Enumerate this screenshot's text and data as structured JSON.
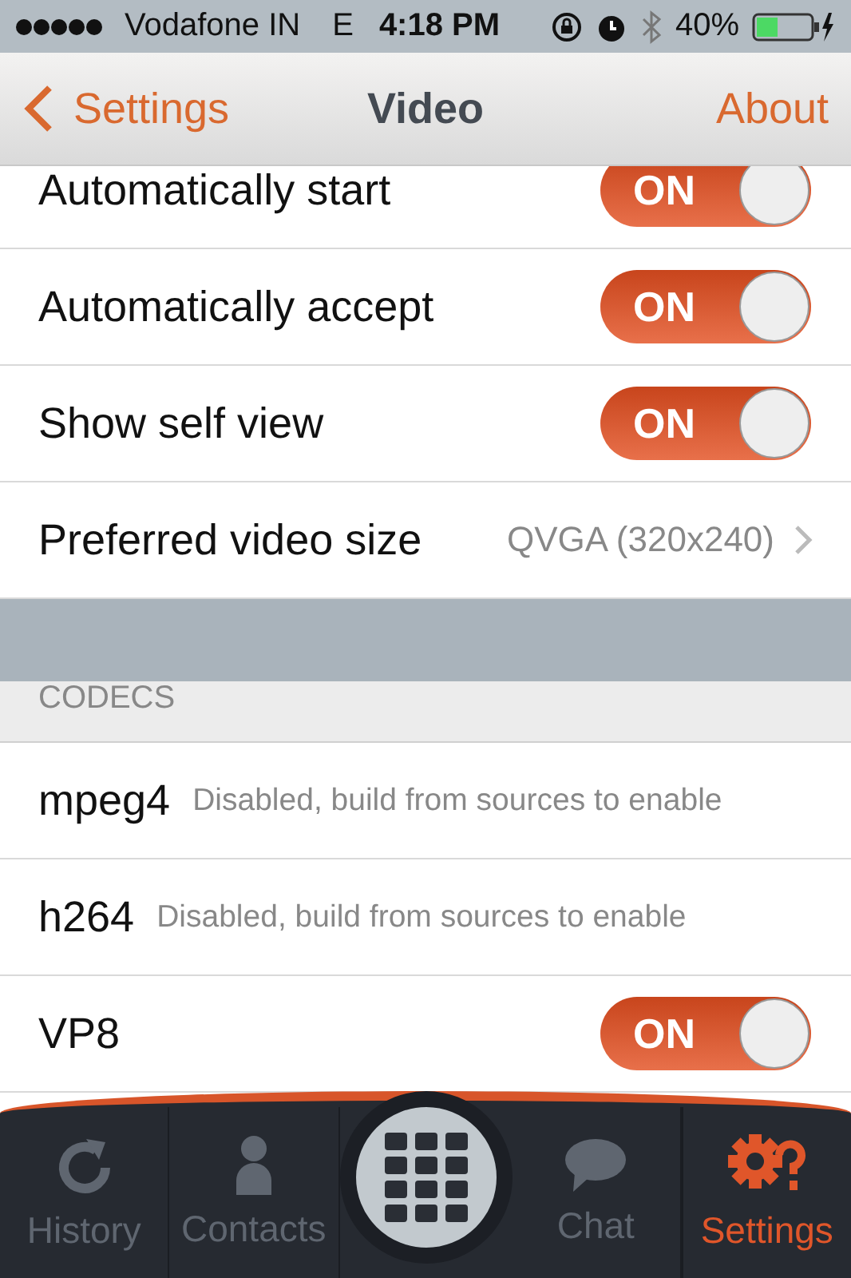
{
  "status_bar": {
    "carrier": "Vodafone IN",
    "network": "E",
    "time": "4:18 PM",
    "battery": "40%"
  },
  "nav": {
    "back": "Settings",
    "title": "Video",
    "action": "About"
  },
  "rows": [
    {
      "kind": "toggle",
      "label": "Automatically start",
      "on": true,
      "switch_label": "ON"
    },
    {
      "kind": "toggle",
      "label": "Automatically accept",
      "on": true,
      "switch_label": "ON"
    },
    {
      "kind": "toggle",
      "label": "Show self view",
      "on": true,
      "switch_label": "ON"
    },
    {
      "kind": "link",
      "label": "Preferred video size",
      "value": "QVGA (320x240)"
    }
  ],
  "section": {
    "header": "CODECS"
  },
  "codecs": [
    {
      "kind": "info",
      "label": "mpeg4",
      "note": "Disabled, build from sources to enable"
    },
    {
      "kind": "info",
      "label": "h264",
      "note": "Disabled, build from sources to enable"
    },
    {
      "kind": "toggle",
      "label": "VP8",
      "on": true,
      "switch_label": "ON"
    }
  ],
  "tab_bar": [
    {
      "kind": "history",
      "label": "History",
      "selected": false
    },
    {
      "kind": "contacts",
      "label": "Contacts",
      "selected": false
    },
    {
      "kind": "dialer",
      "selected": false
    },
    {
      "kind": "chat",
      "label": "Chat",
      "selected": false
    },
    {
      "kind": "settings",
      "label": "Settings",
      "selected": true
    }
  ]
}
